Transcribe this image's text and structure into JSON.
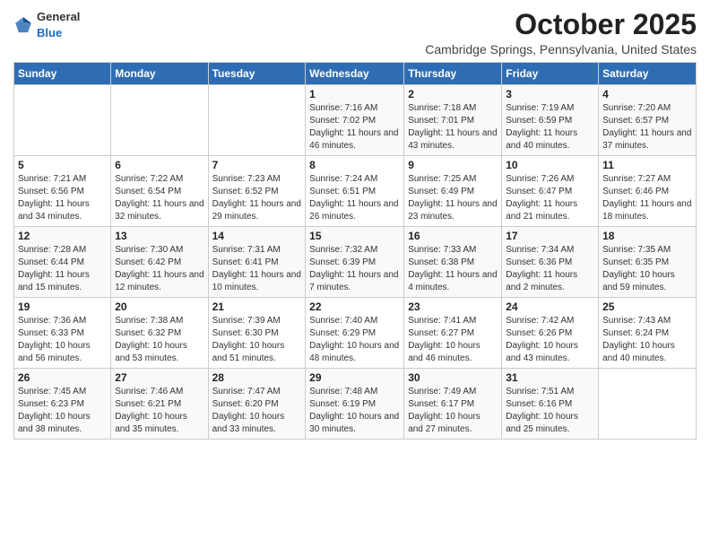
{
  "logo": {
    "general": "General",
    "blue": "Blue"
  },
  "title": "October 2025",
  "location": "Cambridge Springs, Pennsylvania, United States",
  "weekdays": [
    "Sunday",
    "Monday",
    "Tuesday",
    "Wednesday",
    "Thursday",
    "Friday",
    "Saturday"
  ],
  "weeks": [
    [
      {
        "day": "",
        "info": ""
      },
      {
        "day": "",
        "info": ""
      },
      {
        "day": "",
        "info": ""
      },
      {
        "day": "1",
        "info": "Sunrise: 7:16 AM\nSunset: 7:02 PM\nDaylight: 11 hours and 46 minutes."
      },
      {
        "day": "2",
        "info": "Sunrise: 7:18 AM\nSunset: 7:01 PM\nDaylight: 11 hours and 43 minutes."
      },
      {
        "day": "3",
        "info": "Sunrise: 7:19 AM\nSunset: 6:59 PM\nDaylight: 11 hours and 40 minutes."
      },
      {
        "day": "4",
        "info": "Sunrise: 7:20 AM\nSunset: 6:57 PM\nDaylight: 11 hours and 37 minutes."
      }
    ],
    [
      {
        "day": "5",
        "info": "Sunrise: 7:21 AM\nSunset: 6:56 PM\nDaylight: 11 hours and 34 minutes."
      },
      {
        "day": "6",
        "info": "Sunrise: 7:22 AM\nSunset: 6:54 PM\nDaylight: 11 hours and 32 minutes."
      },
      {
        "day": "7",
        "info": "Sunrise: 7:23 AM\nSunset: 6:52 PM\nDaylight: 11 hours and 29 minutes."
      },
      {
        "day": "8",
        "info": "Sunrise: 7:24 AM\nSunset: 6:51 PM\nDaylight: 11 hours and 26 minutes."
      },
      {
        "day": "9",
        "info": "Sunrise: 7:25 AM\nSunset: 6:49 PM\nDaylight: 11 hours and 23 minutes."
      },
      {
        "day": "10",
        "info": "Sunrise: 7:26 AM\nSunset: 6:47 PM\nDaylight: 11 hours and 21 minutes."
      },
      {
        "day": "11",
        "info": "Sunrise: 7:27 AM\nSunset: 6:46 PM\nDaylight: 11 hours and 18 minutes."
      }
    ],
    [
      {
        "day": "12",
        "info": "Sunrise: 7:28 AM\nSunset: 6:44 PM\nDaylight: 11 hours and 15 minutes."
      },
      {
        "day": "13",
        "info": "Sunrise: 7:30 AM\nSunset: 6:42 PM\nDaylight: 11 hours and 12 minutes."
      },
      {
        "day": "14",
        "info": "Sunrise: 7:31 AM\nSunset: 6:41 PM\nDaylight: 11 hours and 10 minutes."
      },
      {
        "day": "15",
        "info": "Sunrise: 7:32 AM\nSunset: 6:39 PM\nDaylight: 11 hours and 7 minutes."
      },
      {
        "day": "16",
        "info": "Sunrise: 7:33 AM\nSunset: 6:38 PM\nDaylight: 11 hours and 4 minutes."
      },
      {
        "day": "17",
        "info": "Sunrise: 7:34 AM\nSunset: 6:36 PM\nDaylight: 11 hours and 2 minutes."
      },
      {
        "day": "18",
        "info": "Sunrise: 7:35 AM\nSunset: 6:35 PM\nDaylight: 10 hours and 59 minutes."
      }
    ],
    [
      {
        "day": "19",
        "info": "Sunrise: 7:36 AM\nSunset: 6:33 PM\nDaylight: 10 hours and 56 minutes."
      },
      {
        "day": "20",
        "info": "Sunrise: 7:38 AM\nSunset: 6:32 PM\nDaylight: 10 hours and 53 minutes."
      },
      {
        "day": "21",
        "info": "Sunrise: 7:39 AM\nSunset: 6:30 PM\nDaylight: 10 hours and 51 minutes."
      },
      {
        "day": "22",
        "info": "Sunrise: 7:40 AM\nSunset: 6:29 PM\nDaylight: 10 hours and 48 minutes."
      },
      {
        "day": "23",
        "info": "Sunrise: 7:41 AM\nSunset: 6:27 PM\nDaylight: 10 hours and 46 minutes."
      },
      {
        "day": "24",
        "info": "Sunrise: 7:42 AM\nSunset: 6:26 PM\nDaylight: 10 hours and 43 minutes."
      },
      {
        "day": "25",
        "info": "Sunrise: 7:43 AM\nSunset: 6:24 PM\nDaylight: 10 hours and 40 minutes."
      }
    ],
    [
      {
        "day": "26",
        "info": "Sunrise: 7:45 AM\nSunset: 6:23 PM\nDaylight: 10 hours and 38 minutes."
      },
      {
        "day": "27",
        "info": "Sunrise: 7:46 AM\nSunset: 6:21 PM\nDaylight: 10 hours and 35 minutes."
      },
      {
        "day": "28",
        "info": "Sunrise: 7:47 AM\nSunset: 6:20 PM\nDaylight: 10 hours and 33 minutes."
      },
      {
        "day": "29",
        "info": "Sunrise: 7:48 AM\nSunset: 6:19 PM\nDaylight: 10 hours and 30 minutes."
      },
      {
        "day": "30",
        "info": "Sunrise: 7:49 AM\nSunset: 6:17 PM\nDaylight: 10 hours and 27 minutes."
      },
      {
        "day": "31",
        "info": "Sunrise: 7:51 AM\nSunset: 6:16 PM\nDaylight: 10 hours and 25 minutes."
      },
      {
        "day": "",
        "info": ""
      }
    ]
  ]
}
